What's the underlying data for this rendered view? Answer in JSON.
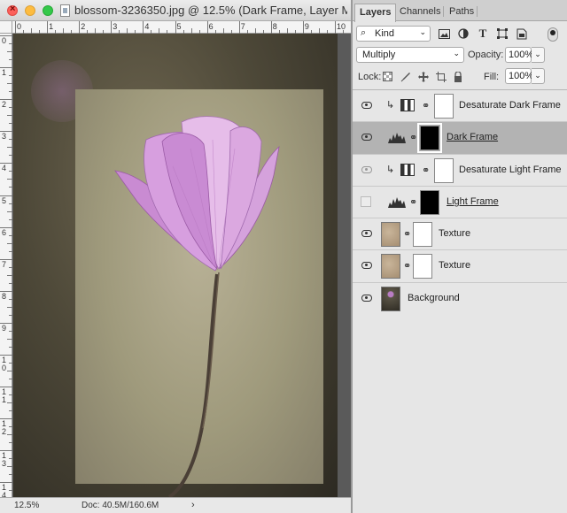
{
  "document": {
    "title": "blossom-3236350.jpg @ 12.5% (Dark Frame, Layer M...",
    "ruler_top_numbers": [
      "0",
      "1",
      "2",
      "3",
      "4",
      "5",
      "6",
      "7",
      "8",
      "9",
      "10"
    ],
    "ruler_left_numbers": [
      "0",
      "1",
      "2",
      "3",
      "4",
      "5",
      "6",
      "7",
      "8",
      "9",
      "1\n0",
      "1\n1",
      "1\n2",
      "1\n3",
      "1\n4"
    ],
    "zoom": "12.5%",
    "doc_size": "Doc: 40.5M/160.6M",
    "status_arrow": "›"
  },
  "panel": {
    "tabs": [
      "Layers",
      "Channels",
      "Paths"
    ],
    "kind_label": "Kind",
    "blend_mode": "Multiply",
    "opacity_label": "Opacity:",
    "opacity_value": "100%",
    "lock_label": "Lock:",
    "fill_label": "Fill:",
    "fill_value": "100%",
    "layers": [
      {
        "name": "Desaturate Dark Frame",
        "visible": true,
        "selected": false
      },
      {
        "name": "Dark Frame",
        "visible": true,
        "selected": true
      },
      {
        "name": "Desaturate Light Frame",
        "visible": true,
        "selected": false
      },
      {
        "name": "Light Frame",
        "visible": false,
        "selected": false
      },
      {
        "name": "Texture",
        "visible": true,
        "selected": false
      },
      {
        "name": "Texture",
        "visible": true,
        "selected": false
      },
      {
        "name": "Background",
        "visible": true,
        "selected": false
      }
    ]
  }
}
